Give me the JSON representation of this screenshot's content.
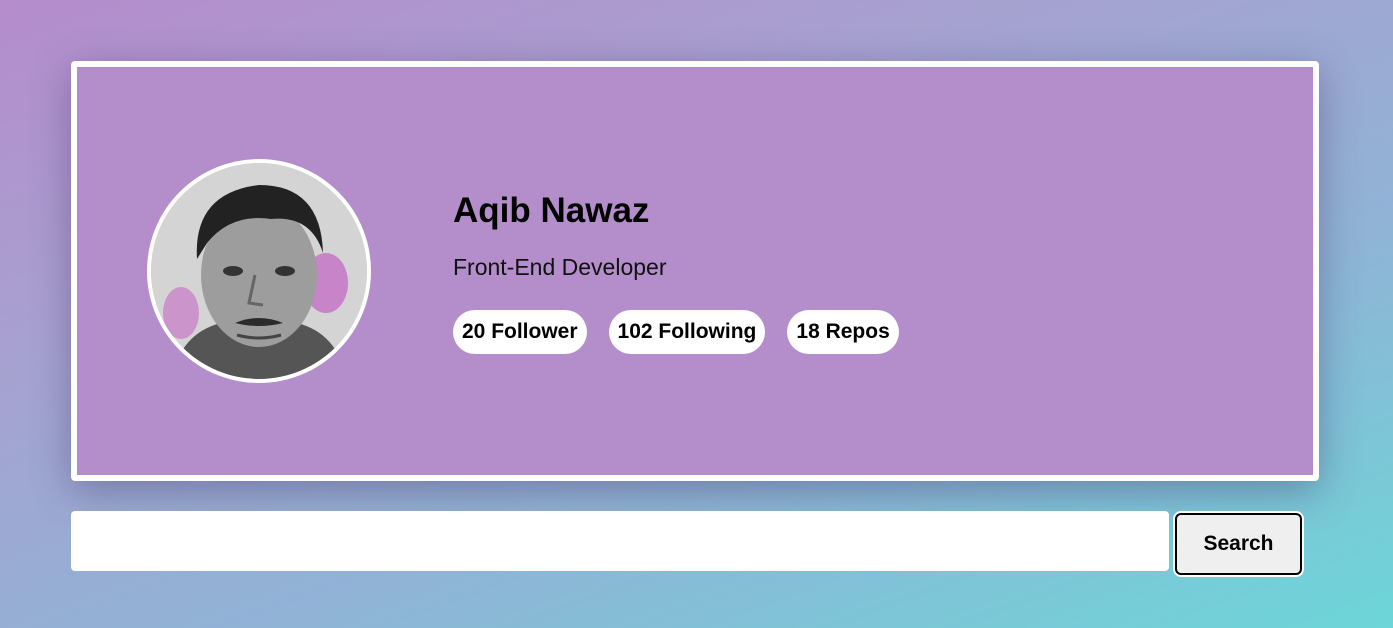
{
  "profile": {
    "name": "Aqib Nawaz",
    "bio": "Front-End Developer",
    "avatar_alt": "Aqib Nawaz",
    "stats": {
      "followers": "20 Follower",
      "following": "102 Following",
      "repos": "18 Repos"
    }
  },
  "search": {
    "value": "",
    "placeholder": "",
    "button_label": "Search"
  },
  "colors": {
    "card_background": "#b48dcb",
    "card_border": "#ffffff",
    "pill_background": "#ffffff",
    "gradient_start": "#b58ccc",
    "gradient_end": "#6cd6d8"
  }
}
